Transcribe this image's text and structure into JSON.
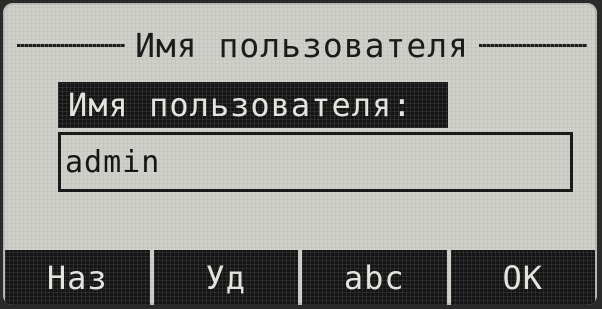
{
  "header": {
    "title": "Имя пользователя"
  },
  "form": {
    "label": "Имя пользователя:",
    "value": "admin"
  },
  "softkeys": [
    {
      "label": "Наз"
    },
    {
      "label": "Уд"
    },
    {
      "label": "abc"
    },
    {
      "label": "OK"
    }
  ]
}
